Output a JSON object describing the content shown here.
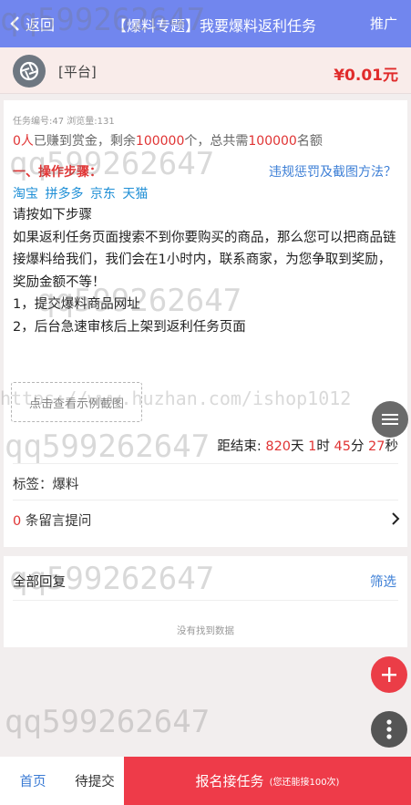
{
  "header": {
    "back_label": "返回",
    "title": "【爆料专题】我要爆料返利任务",
    "promo_label": "推广"
  },
  "platform": {
    "name": "[平台]",
    "price": "¥0.01元"
  },
  "task": {
    "meta": "任务编号:47 浏览量:131",
    "earned_count": "0人",
    "earned_text1": "已赚到赏金，剩余",
    "remaining": "100000",
    "earned_text2": "个，总共需",
    "total": "100000",
    "earned_text3": "名额"
  },
  "steps": {
    "heading": "一、操作步骤：",
    "penalty_link": "违规惩罚及截图方法？",
    "shops": [
      "淘宝",
      "拼多多",
      "京东",
      "天猫"
    ],
    "lines": [
      "请按如下步骤",
      "如果返利任务页面搜索不到你要购买的商品，那么您可以把商品链接爆料给我们，我们会在1小时内，联系商家，为您争取到奖励，奖励金额不等！",
      "1，提交爆料商品网址",
      "2，后台急速审核后上架到返利任务页面"
    ],
    "example_button": "点击查看示例截图"
  },
  "countdown": {
    "prefix": "距结束:",
    "days": "820",
    "days_unit": "天",
    "hours": "1",
    "hours_unit": "时",
    "minutes": "45",
    "minutes_unit": "分",
    "seconds": "27",
    "seconds_unit": "秒"
  },
  "tag": "标签：爆料",
  "comments": {
    "count": "0",
    "label": "条留言提问"
  },
  "replies": {
    "title": "全部回复",
    "filter": "筛选",
    "empty": "没有找到数据"
  },
  "bottom": {
    "home": "首页",
    "pending": "待提交",
    "signup": "报名接任务",
    "signup_note": "(您还能接100次)"
  },
  "watermarks": {
    "qq": "qq599262647",
    "url": "https://www.huzhan.com/ishop1012"
  },
  "colors": {
    "header_bg": "#7186ee",
    "price": "#e02b2b",
    "link": "#3d7fd6",
    "action": "#ee3b49"
  }
}
